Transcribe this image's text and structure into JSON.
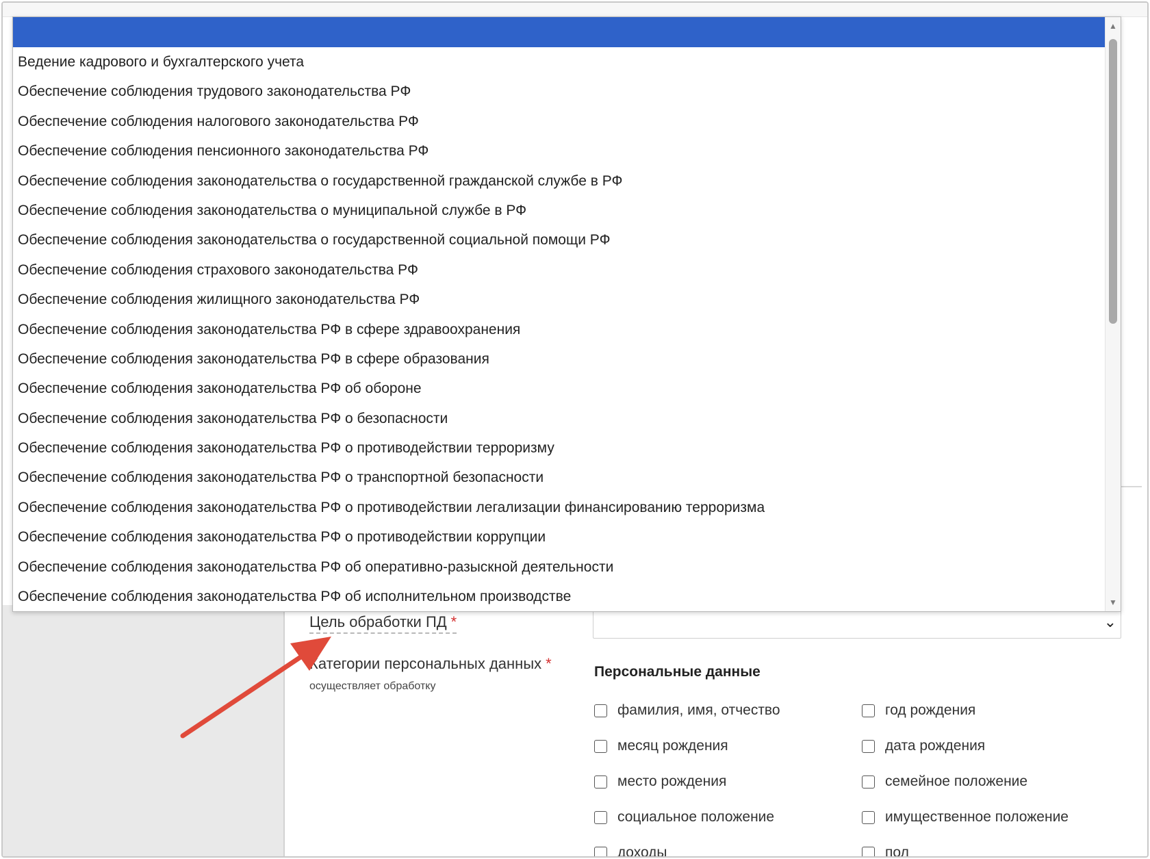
{
  "dropdown": {
    "selected_item": "",
    "items": [
      "Ведение кадрового и бухгалтерского учета",
      "Обеспечение соблюдения трудового законодательства РФ",
      "Обеспечение соблюдения налогового законодательства РФ",
      "Обеспечение соблюдения пенсионного законодательства РФ",
      "Обеспечение соблюдения законодательства о государственной гражданской службе в РФ",
      "Обеспечение соблюдения законодательства о муниципальной службе в РФ",
      "Обеспечение соблюдения законодательства о государственной социальной помощи РФ",
      "Обеспечение соблюдения страхового законодательства РФ",
      "Обеспечение соблюдения жилищного законодательства РФ",
      "Обеспечение соблюдения законодательства РФ в сфере здравоохранения",
      "Обеспечение соблюдения законодательства РФ в сфере образования",
      "Обеспечение соблюдения законодательства РФ об обороне",
      "Обеспечение соблюдения законодательства РФ о безопасности",
      "Обеспечение соблюдения законодательства РФ о противодействии терроризму",
      "Обеспечение соблюдения законодательства РФ о транспортной безопасности",
      "Обеспечение соблюдения законодательства РФ о противодействии легализации финансированию терроризма",
      "Обеспечение соблюдения законодательства РФ о противодействии коррупции",
      "Обеспечение соблюдения законодательства РФ об оперативно-разыскной деятельности",
      "Обеспечение соблюдения законодательства РФ об исполнительном производстве"
    ],
    "scroll_position": 0.0
  },
  "form": {
    "purpose_label": "Цель обработки ПД",
    "required_mark": "*",
    "purpose_value": "",
    "categories_label": "Категории персональных данных",
    "categories_sub": "осуществляет обработку",
    "personal_data_heading": "Персональные данные",
    "checkboxes": [
      "фамилия, имя, отчество",
      "год рождения",
      "месяц рождения",
      "дата рождения",
      "место рождения",
      "семейное положение",
      "социальное положение",
      "имущественное положение",
      "доходы",
      "пол"
    ]
  },
  "colors": {
    "selection": "#2f62c9",
    "required": "#d32f2f",
    "annotation_arrow": "#e04a3a"
  },
  "icons": {
    "scroll_up": "triangle-up",
    "scroll_down": "triangle-down",
    "select_chevron": "chevron-down",
    "annotation": "red-arrow"
  }
}
